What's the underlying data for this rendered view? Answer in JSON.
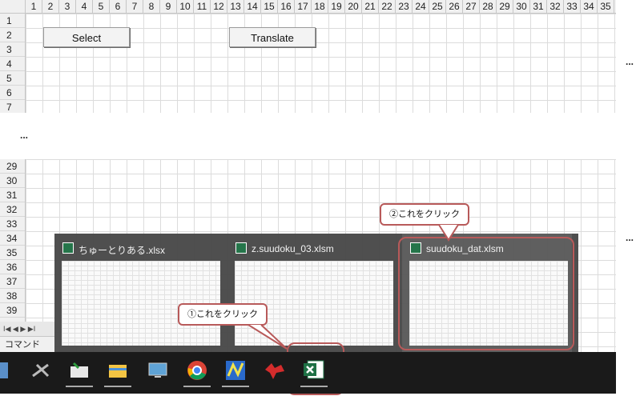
{
  "columns": [
    "1",
    "2",
    "3",
    "4",
    "5",
    "6",
    "7",
    "8",
    "9",
    "10",
    "11",
    "12",
    "13",
    "14",
    "15",
    "16",
    "17",
    "18",
    "19",
    "20",
    "21",
    "22",
    "23",
    "24",
    "25",
    "26",
    "27",
    "28",
    "29",
    "30",
    "31",
    "32",
    "33",
    "34",
    "35"
  ],
  "top_rows": [
    "1",
    "2",
    "3",
    "4",
    "5",
    "6",
    "7"
  ],
  "bottom_rows": [
    "29",
    "30",
    "31",
    "32",
    "33",
    "34",
    "35",
    "36",
    "37",
    "38",
    "39"
  ],
  "buttons": {
    "select": "Select",
    "translate": "Translate"
  },
  "ellipsis": "...",
  "previews": [
    {
      "title": "ちゅーとりある.xlsx"
    },
    {
      "title": "z.suudoku_03.xlsm"
    },
    {
      "title": "suudoku_dat.xlsm"
    }
  ],
  "callouts": {
    "step1": "①これをクリック",
    "step2": "②これをクリック"
  },
  "status": {
    "command": "コマンド",
    "nav": "I◀ ◀ ▶ ▶I"
  },
  "taskbar_icons": [
    "network-icon",
    "tools-icon",
    "mail-icon",
    "file-explorer-icon",
    "monitor-icon",
    "chrome-icon",
    "app-icon",
    "red-bird-icon",
    "excel-icon"
  ],
  "colors": {
    "accent_red": "#b85a5a",
    "excel_green": "#1e7145"
  }
}
